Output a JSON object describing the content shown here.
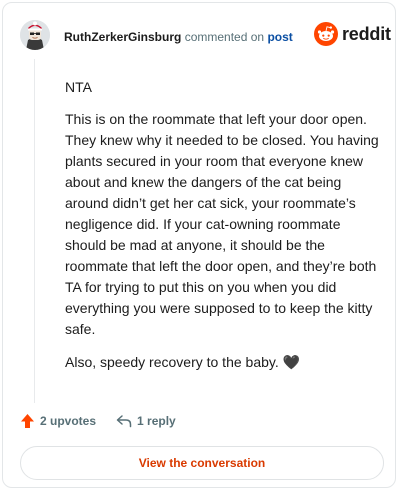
{
  "header": {
    "username": "RuthZerkerGinsburg",
    "action_text": "commented on",
    "post_link": "post",
    "brand": "reddit"
  },
  "comment": {
    "paragraphs": [
      "NTA",
      "This is on the roommate that left your door open. They knew why it needed to be closed. You having plants secured in your room that everyone knew about and knew the dangers of the cat being around didn’t get her cat sick, your roommate’s negligence did. If your cat-owning roommate should be mad at anyone, it should be the roommate that left the door open, and they’re both TA for trying to put this on you when you did everything you were supposed to to keep the kitty safe.",
      "Also, speedy recovery to the baby. 🖤"
    ]
  },
  "actions": {
    "upvotes": "2 upvotes",
    "replies": "1 reply"
  },
  "footer": {
    "button_label": "View the conversation"
  },
  "colors": {
    "upvote": "#ff4500",
    "link": "#0b4fa3",
    "cta": "#d93a00",
    "muted": "#576f76"
  },
  "icons": [
    "avatar",
    "reddit-logo-icon",
    "upvote-arrow-icon",
    "reply-arrow-icon"
  ]
}
